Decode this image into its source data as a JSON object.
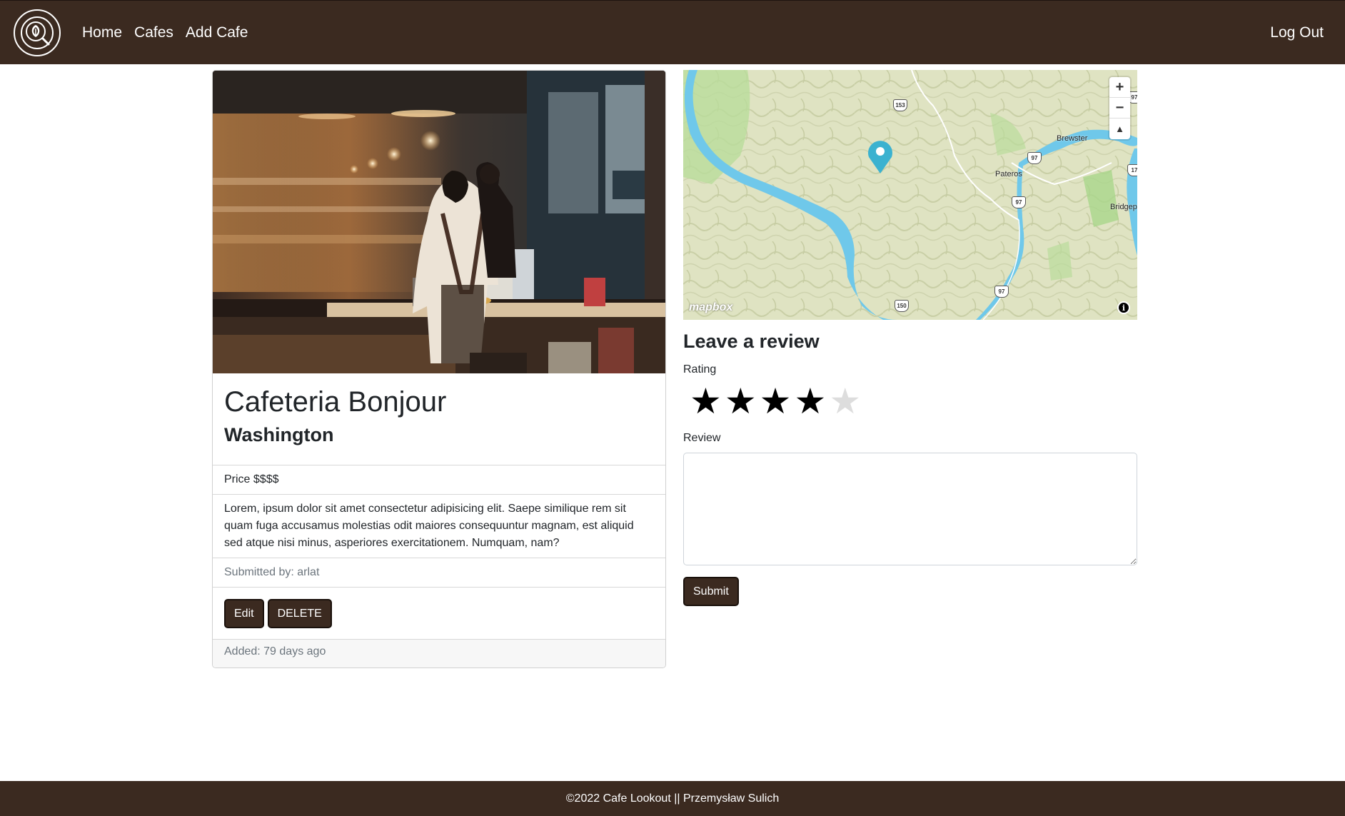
{
  "nav": {
    "logo_icon": "coffee-latte-art-logo",
    "links": [
      "Home",
      "Cafes",
      "Add Cafe"
    ],
    "logout": "Log Out"
  },
  "cafe": {
    "title": "Cafeteria Bonjour",
    "location": "Washington",
    "price": "Price $$$$",
    "description": "Lorem, ipsum dolor sit amet consectetur adipisicing elit. Saepe similique rem sit quam fuga accusamus molestias odit maiores consequuntur magnam, est aliquid sed atque nisi minus, asperiores exercitationem. Numquam, nam?",
    "submitted_by": "Submitted by: arlat",
    "edit_label": "Edit",
    "delete_label": "DELETE",
    "added": "Added: 79 days ago"
  },
  "map": {
    "attribution": "mapbox",
    "zoom_in": "+",
    "zoom_out": "−",
    "compass": "▲",
    "info": "i",
    "labels": [
      "Brewster",
      "Pateros",
      "Bridgep"
    ],
    "route_shields": [
      "153",
      "97",
      "97",
      "97",
      "150",
      "17",
      "97"
    ]
  },
  "review": {
    "title": "Leave a review",
    "rating_label": "Rating",
    "rating": 4,
    "rating_max": 5,
    "review_label": "Review",
    "review_value": "",
    "submit_label": "Submit"
  },
  "footer": {
    "text": "©2022 Cafe Lookout || Przemysław Sulich"
  },
  "colors": {
    "brand": "#3b2a20",
    "water": "#6fc8ea",
    "marker": "#3bb2d0"
  }
}
